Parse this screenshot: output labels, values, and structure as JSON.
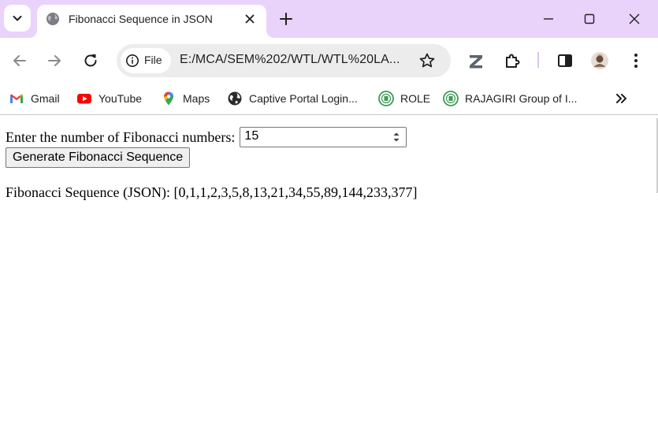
{
  "browser": {
    "tab": {
      "title": "Fibonacci Sequence in JSON"
    },
    "omnibox": {
      "chip_label": "File",
      "url": "E:/MCA/SEM%202/WTL/WTL%20LA..."
    },
    "bookmarks": [
      {
        "label": "Gmail",
        "icon": "gmail-icon"
      },
      {
        "label": "YouTube",
        "icon": "youtube-icon"
      },
      {
        "label": "Maps",
        "icon": "maps-icon"
      },
      {
        "label": "Captive Portal Login...",
        "icon": "globe-icon"
      },
      {
        "label": "ROLE",
        "icon": "rajagiri-logo-icon"
      },
      {
        "label": "RAJAGIRI Group of I...",
        "icon": "rajagiri-logo-icon"
      }
    ],
    "colors": {
      "tabstrip": "#e9d3fb",
      "omnibox": "#ececec"
    }
  },
  "page": {
    "prompt_label": "Enter the number of Fibonacci numbers:",
    "count_value": "15",
    "generate_button": "Generate Fibonacci Sequence",
    "result_label": "Fibonacci Sequence (JSON):",
    "result_value": "[0,1,1,2,3,5,8,13,21,34,55,89,144,233,377]"
  }
}
